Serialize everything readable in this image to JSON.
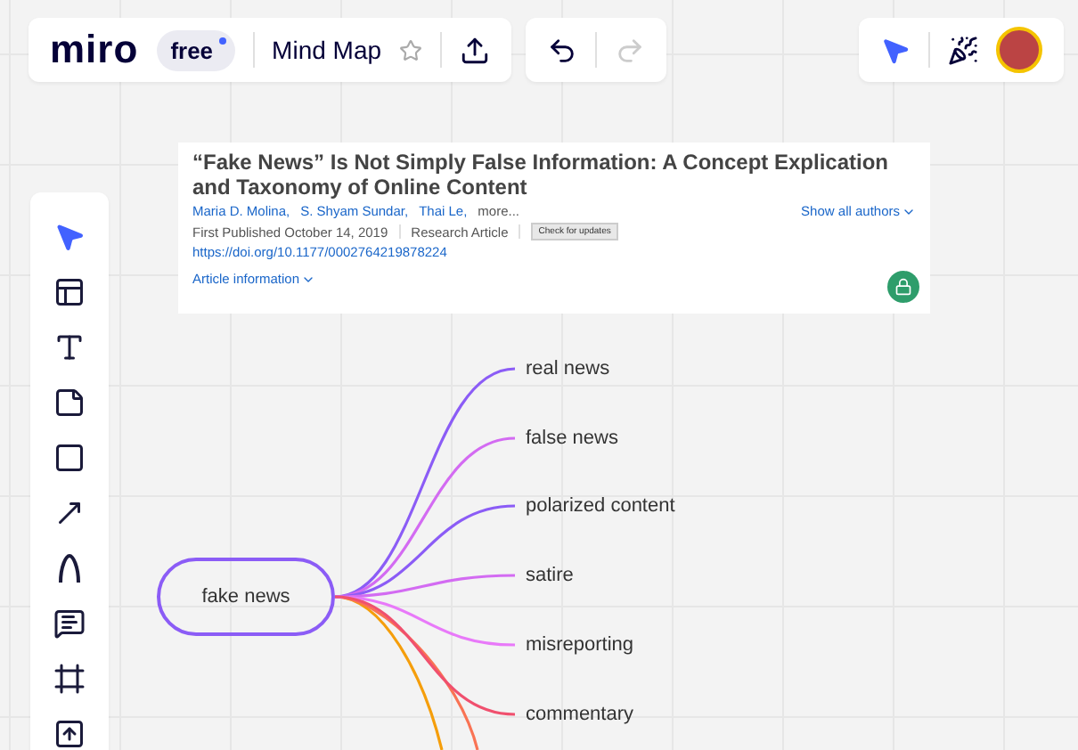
{
  "topbar": {
    "logo": "miro",
    "plan_badge": "free",
    "board_title": "Mind Map",
    "starred": false,
    "redo_disabled": true
  },
  "tools": [
    {
      "kind": "select",
      "selected": true
    },
    {
      "kind": "templates",
      "selected": false
    },
    {
      "kind": "text",
      "selected": false
    },
    {
      "kind": "sticky",
      "selected": false
    },
    {
      "kind": "shape",
      "selected": false
    },
    {
      "kind": "arrow",
      "selected": false
    },
    {
      "kind": "pen",
      "selected": false
    },
    {
      "kind": "comment",
      "selected": false
    },
    {
      "kind": "frame",
      "selected": false
    },
    {
      "kind": "upload",
      "selected": false
    }
  ],
  "article": {
    "title": "“Fake News” Is Not Simply False Information: A Concept Explication and Taxonomy of Online Content",
    "authors": [
      "Maria D. Molina,",
      "S. Shyam Sundar,",
      "Thai Le,"
    ],
    "more": "more...",
    "show_all": "Show all authors",
    "published": "First Published October 14, 2019",
    "type": "Research Article",
    "updates_badge": "Check for updates",
    "doi": "https://doi.org/10.1177/0002764219878224",
    "info": "Article information"
  },
  "mindmap": {
    "root": "fake news",
    "branches": [
      {
        "label": "real news",
        "color": "#8b5cf6"
      },
      {
        "label": "false news",
        "color": "#d36bf2"
      },
      {
        "label": "polarized content",
        "color": "#8b5cf6"
      },
      {
        "label": "satire",
        "color": "#d36bf2"
      },
      {
        "label": "misreporting",
        "color": "#e879f9"
      },
      {
        "label": "commentary",
        "color": "#f0506e"
      }
    ],
    "offscreen_branches": [
      {
        "color": "#f59e0b"
      },
      {
        "color": "#f97354"
      }
    ]
  }
}
